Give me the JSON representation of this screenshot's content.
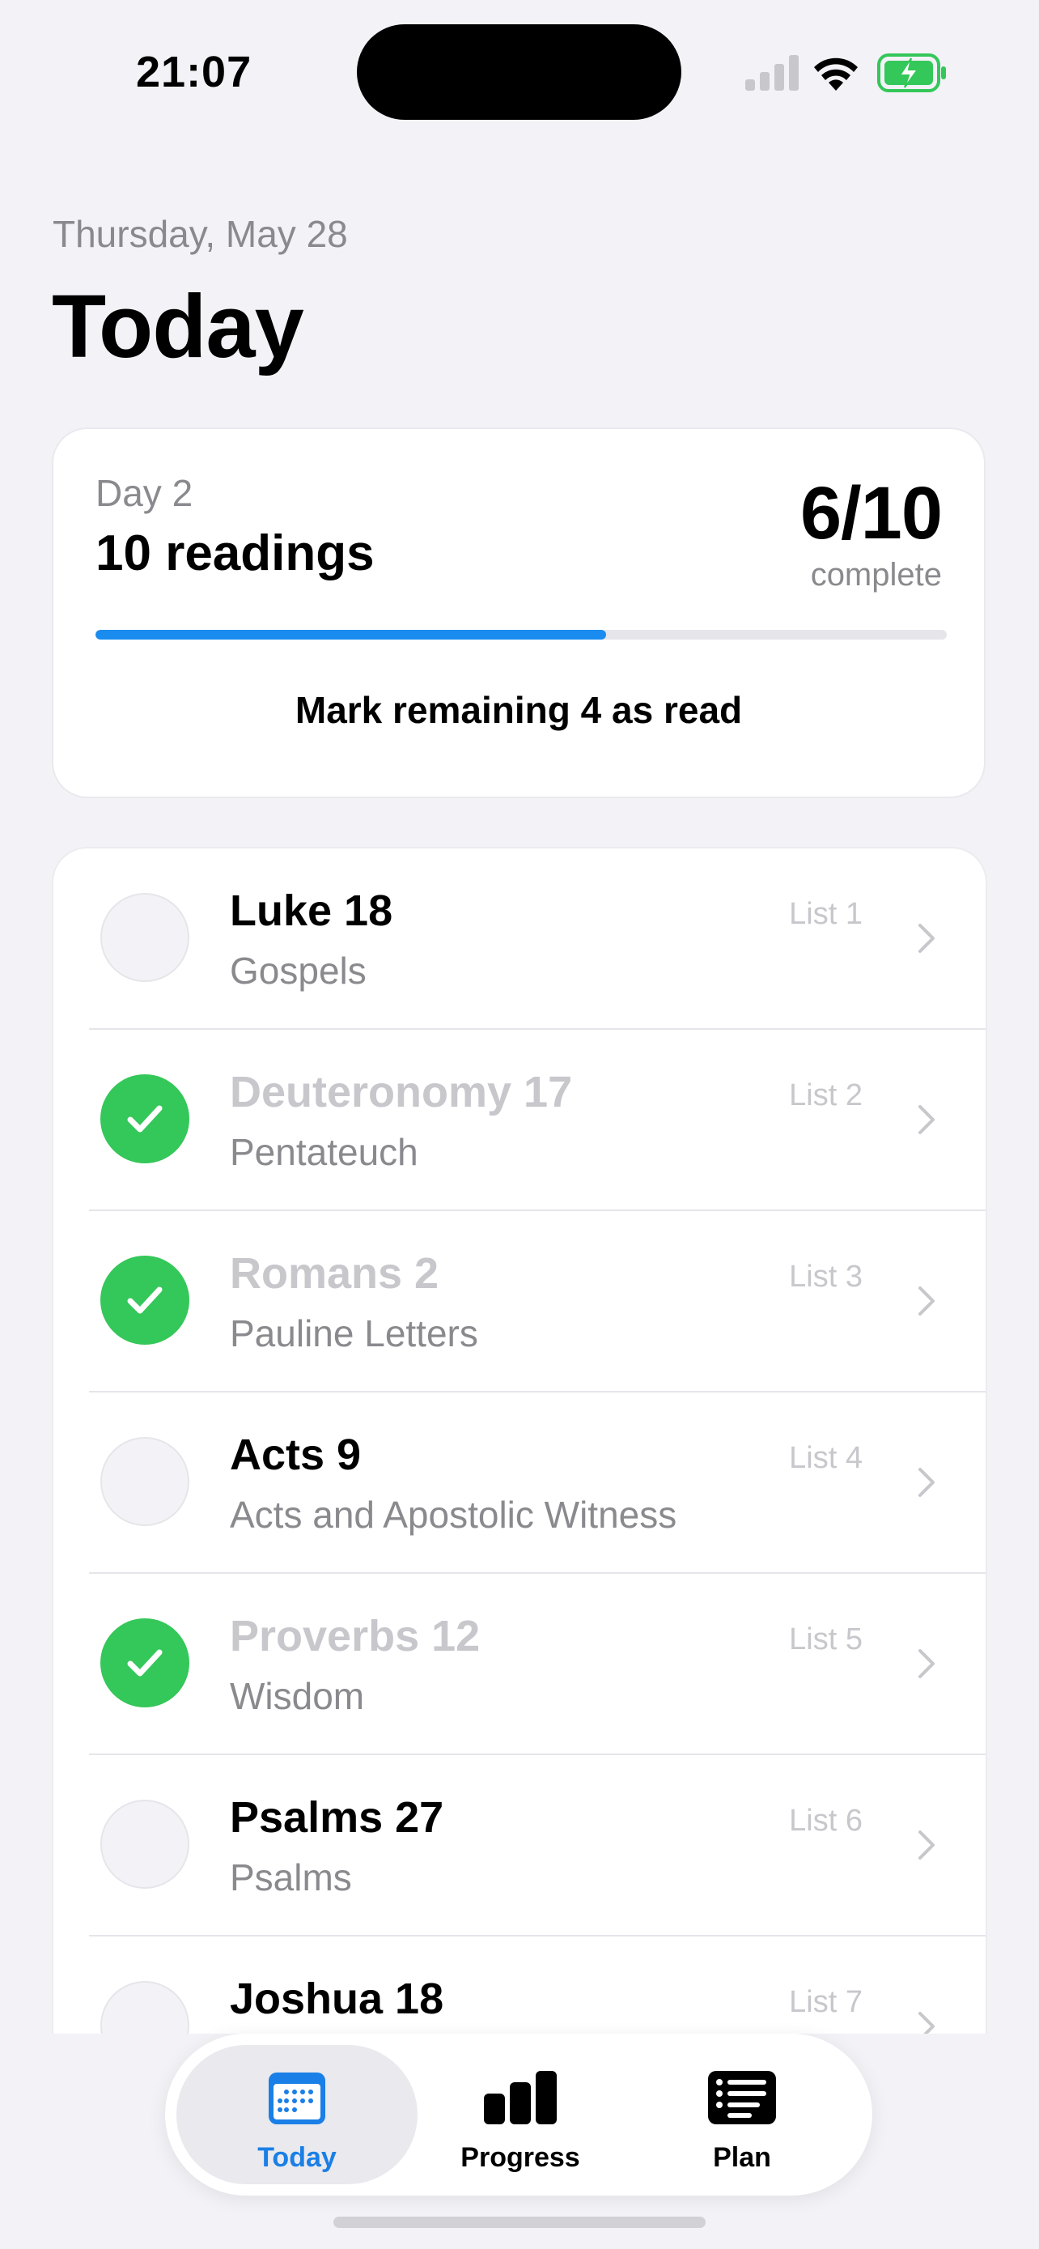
{
  "status": {
    "time": "21:07"
  },
  "header": {
    "date": "Thursday, May 28",
    "title": "Today"
  },
  "summary": {
    "day": "Day 2",
    "readings": "10 readings",
    "score": "6/10",
    "score_label": "complete",
    "progress_fraction": 0.6,
    "mark_button": "Mark remaining 4 as read"
  },
  "readings": [
    {
      "title": "Luke 18",
      "category": "Gospels",
      "list": "List 1",
      "done": false
    },
    {
      "title": "Deuteronomy 17",
      "category": "Pentateuch",
      "list": "List 2",
      "done": true
    },
    {
      "title": "Romans 2",
      "category": "Pauline Letters",
      "list": "List 3",
      "done": true
    },
    {
      "title": "Acts 9",
      "category": "Acts and Apostolic Witness",
      "list": "List 4",
      "done": false
    },
    {
      "title": "Proverbs 12",
      "category": "Wisdom",
      "list": "List 5",
      "done": true
    },
    {
      "title": "Psalms 27",
      "category": "Psalms",
      "list": "List 6",
      "done": false
    },
    {
      "title": "Joshua 18",
      "category": "",
      "list": "List 7",
      "done": false
    }
  ],
  "tabs": [
    {
      "label": "Today",
      "icon": "calendar-icon",
      "active": true
    },
    {
      "label": "Progress",
      "icon": "chart-bars-icon",
      "active": false
    },
    {
      "label": "Plan",
      "icon": "list-icon",
      "active": false
    }
  ],
  "colors": {
    "accent": "#1a8cf0",
    "done": "#34c759",
    "background": "#f2f2f7"
  }
}
